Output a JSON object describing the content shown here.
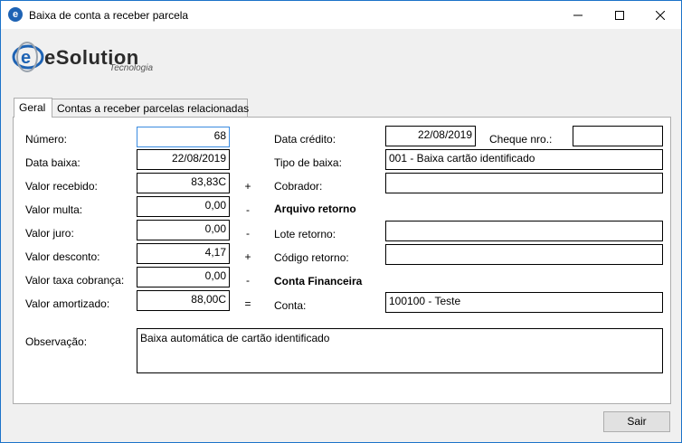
{
  "window": {
    "title": "Baixa de conta a receber parcela",
    "icon": "esolution-app-icon"
  },
  "logo": {
    "word": "eSolution",
    "sub": "Tecnologia"
  },
  "tabs": [
    {
      "label": "Geral",
      "active": true
    },
    {
      "label": "Contas a receber parcelas relacionadas",
      "active": false
    }
  ],
  "form": {
    "numero": {
      "label": "Número:",
      "value": "68"
    },
    "data_baixa": {
      "label": "Data baixa:",
      "value": "22/08/2019"
    },
    "valor_recebido": {
      "label": "Valor recebido:",
      "value": "83,83C",
      "op": "+"
    },
    "valor_multa": {
      "label": "Valor multa:",
      "value": "0,00",
      "op": "-"
    },
    "valor_juro": {
      "label": "Valor juro:",
      "value": "0,00",
      "op": "-"
    },
    "valor_desconto": {
      "label": "Valor desconto:",
      "value": "4,17",
      "op": "+"
    },
    "valor_taxa": {
      "label": "Valor taxa cobrança:",
      "value": "0,00",
      "op": "-"
    },
    "valor_amortizado": {
      "label": "Valor amortizado:",
      "value": "88,00C",
      "op": "="
    },
    "data_credito": {
      "label": "Data crédito:",
      "value": "22/08/2019"
    },
    "cheque": {
      "label": "Cheque nro.:",
      "value": ""
    },
    "tipo_baixa": {
      "label": "Tipo de baixa:",
      "value": "001 - Baixa cartão identificado"
    },
    "cobrador": {
      "label": "Cobrador:",
      "value": ""
    },
    "arquivo_retorno": {
      "heading": "Arquivo retorno"
    },
    "lote_retorno": {
      "label": "Lote retorno:",
      "value": ""
    },
    "codigo_retorno": {
      "label": "Código retorno:",
      "value": ""
    },
    "conta_financeira": {
      "heading": "Conta Financeira"
    },
    "conta": {
      "label": "Conta:",
      "value": "100100 - Teste"
    },
    "observacao": {
      "label": "Observação:",
      "value": "Baixa automática de cartão identificado"
    }
  },
  "buttons": {
    "sair": "Sair"
  },
  "colors": {
    "border_accent": "#1c73c9",
    "focus": "#3a8be0"
  }
}
